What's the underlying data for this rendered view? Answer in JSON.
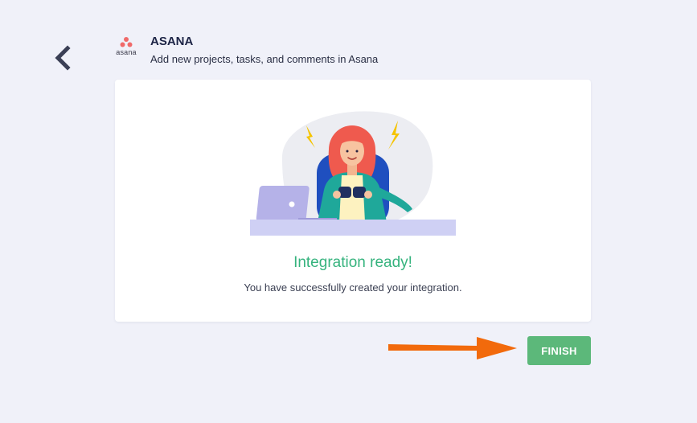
{
  "header": {
    "back_icon": "chevron-left-icon",
    "logo_icon": "asana-logo",
    "logo_text": "asana",
    "title": "ASANA",
    "subtitle": "Add new projects, tasks, and comments in Asana"
  },
  "card": {
    "illustration": "person-celebrating-at-laptop",
    "status_title": "Integration ready!",
    "status_message": "You have successfully created your integration."
  },
  "actions": {
    "finish_label": "FINISH",
    "arrow_icon": "arrow-right-icon"
  },
  "colors": {
    "background": "#f0f1f9",
    "success_text": "#36b37e",
    "finish_button": "#5cb87a",
    "arrow": "#f26a0c",
    "title_text": "#1d2446"
  }
}
